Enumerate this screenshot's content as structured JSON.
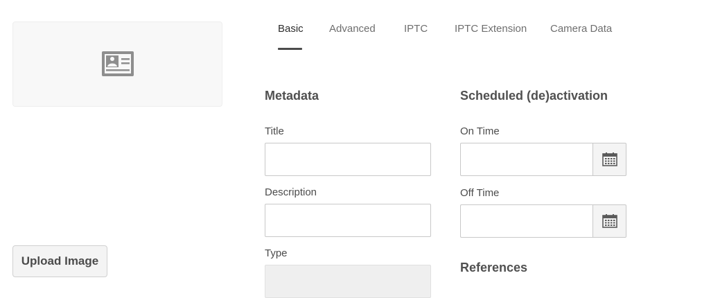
{
  "thumbnail": {
    "icon": "image-placeholder-icon"
  },
  "upload": {
    "label": "Upload Image"
  },
  "tabs": [
    {
      "label": "Basic",
      "active": true
    },
    {
      "label": "Advanced",
      "active": false
    },
    {
      "label": "IPTC",
      "active": false
    },
    {
      "label": "IPTC Extension",
      "active": false
    },
    {
      "label": "Camera Data",
      "active": false
    }
  ],
  "metadata": {
    "heading": "Metadata",
    "title_label": "Title",
    "title_value": "",
    "description_label": "Description",
    "description_value": "",
    "type_label": "Type",
    "type_value": ""
  },
  "schedule": {
    "heading": "Scheduled (de)activation",
    "on_time_label": "On Time",
    "on_time_value": "",
    "off_time_label": "Off Time",
    "off_time_value": "",
    "calendar_icon": "calendar-icon"
  },
  "references": {
    "heading": "References"
  },
  "colors": {
    "accent": "#4b4b4b",
    "border": "#c8c8c8",
    "field_disabled": "#efefef"
  }
}
